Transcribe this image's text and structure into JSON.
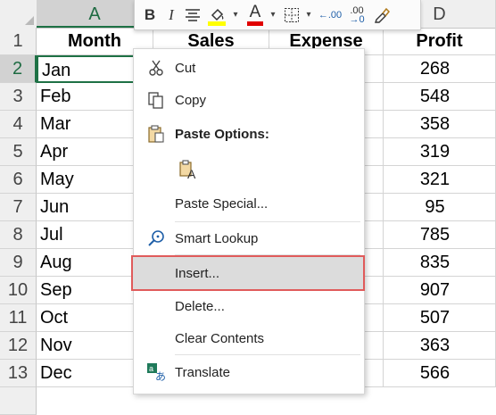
{
  "columns": [
    "A",
    "D"
  ],
  "rows": [
    "1",
    "2",
    "3",
    "4",
    "5",
    "6",
    "7",
    "8",
    "9",
    "10",
    "11",
    "12",
    "13"
  ],
  "headers": {
    "month": "Month",
    "sales": "Sales",
    "expense": "Expense",
    "profit": "Profit"
  },
  "data": [
    {
      "month": "Jan",
      "profit": "268"
    },
    {
      "month": "Feb",
      "profit": "548"
    },
    {
      "month": "Mar",
      "profit": "358"
    },
    {
      "month": "Apr",
      "profit": "319"
    },
    {
      "month": "May",
      "profit": "321"
    },
    {
      "month": "Jun",
      "profit": "95"
    },
    {
      "month": "Jul",
      "profit": "785"
    },
    {
      "month": "Aug",
      "profit": "835"
    },
    {
      "month": "Sep",
      "profit": "907"
    },
    {
      "month": "Oct",
      "profit": "507"
    },
    {
      "month": "Nov",
      "profit": "363"
    },
    {
      "month": "Dec",
      "profit": "566"
    }
  ],
  "toolbar": {
    "bold": "B",
    "italic": "I",
    "font_color_letter": "A",
    "inc_decimal": ".00",
    "dec_decimal": ".00",
    "highlight_color": "#ffff00",
    "font_color": "#e00000"
  },
  "menu": {
    "cut": "Cut",
    "copy": "Copy",
    "paste_options": "Paste Options:",
    "paste_special": "Paste Special...",
    "smart_lookup": "Smart Lookup",
    "insert": "Insert...",
    "delete": "Delete...",
    "clear_contents": "Clear Contents",
    "translate": "Translate"
  },
  "colors": {
    "accent": "#1e7145",
    "highlight_outline": "#e05b5b"
  }
}
